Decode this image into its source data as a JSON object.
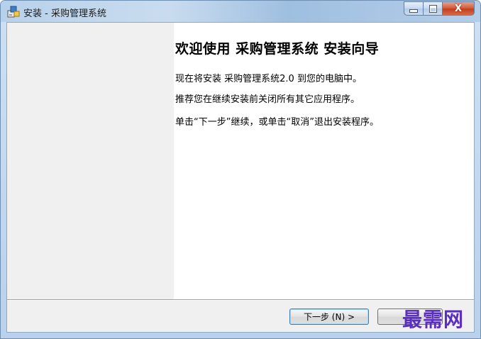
{
  "window": {
    "title": "安装 - 采购管理系统",
    "close_glyph": "X"
  },
  "welcome": {
    "title": "欢迎使用 采购管理系统 安装向导",
    "line1": "现在将安装 采购管理系统2.0 到您的电脑中。",
    "line2": "推荐您在继续安装前关闭所有其它应用程序。",
    "line3": "单击“下一步”继续，或单击“取消”退出安装程序。"
  },
  "buttons": {
    "next_label": "下一步 (N) >",
    "cancel_label": ""
  },
  "watermark": {
    "text": "最需网"
  },
  "colors": {
    "accent": "#3c7fb1",
    "watermark": "#5a2fbf",
    "close_button": "#c4401d"
  }
}
